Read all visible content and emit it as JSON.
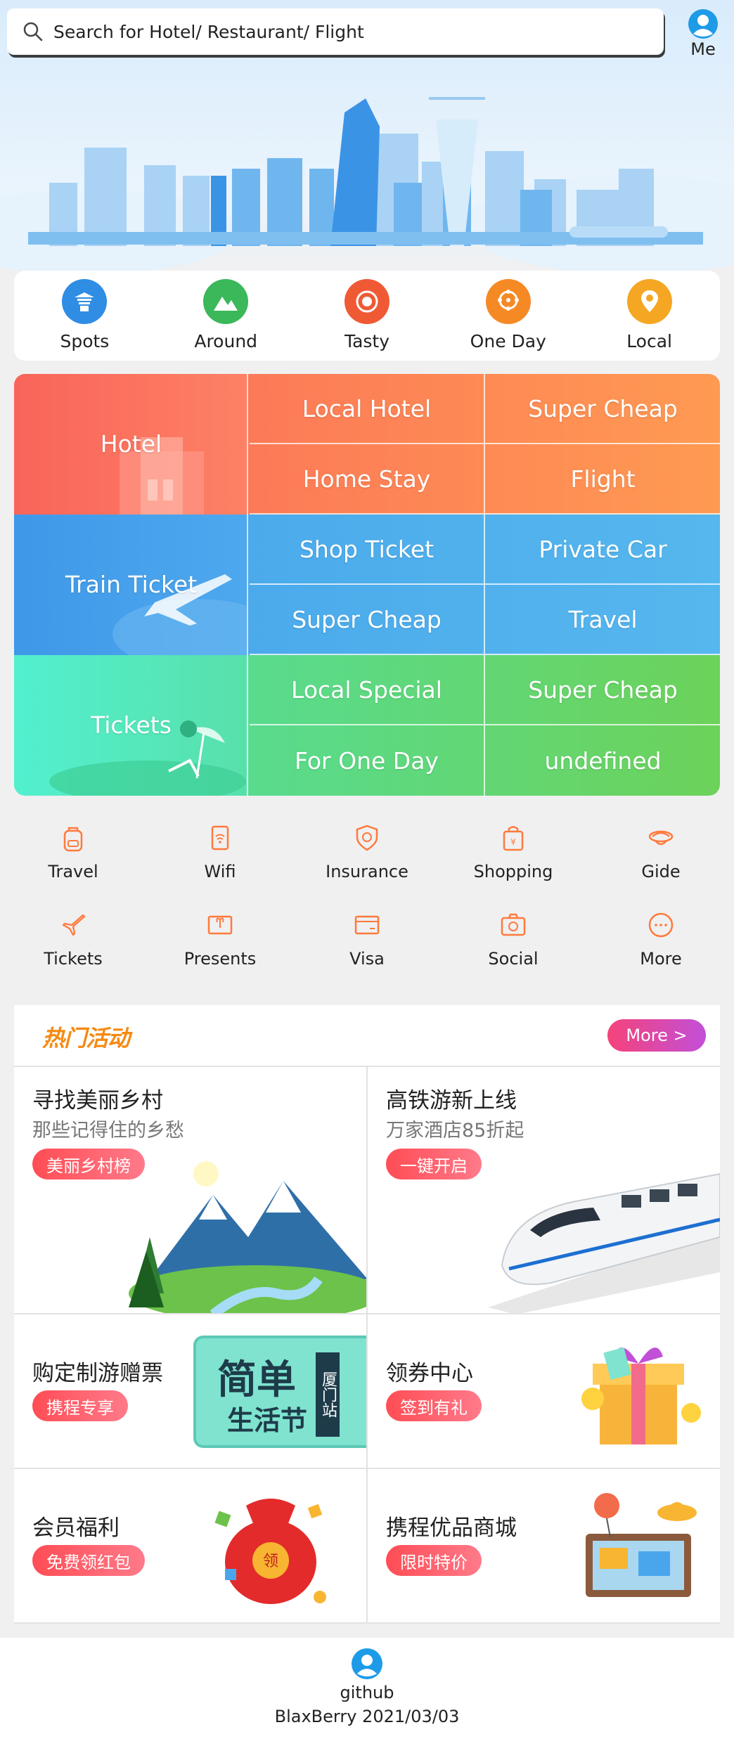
{
  "search": {
    "placeholder": "Search for Hotel/ Restaurant/ Flight",
    "icon": "search-icon"
  },
  "header": {
    "me_label": "Me"
  },
  "quick_nav": [
    {
      "label": "Spots",
      "icon": "pagoda-icon",
      "color": "#2f8de4"
    },
    {
      "label": "Around",
      "icon": "mountain-icon",
      "color": "#3bb85a"
    },
    {
      "label": "Tasty",
      "icon": "food-icon",
      "color": "#ef5a35"
    },
    {
      "label": "One Day",
      "icon": "ferris-wheel-icon",
      "color": "#f58a25"
    },
    {
      "label": "Local",
      "icon": "location-icon",
      "color": "#f5a623"
    }
  ],
  "grid": {
    "hotel": {
      "label": "Hotel",
      "cells": [
        "Local Hotel",
        "Super Cheap",
        "Home Stay",
        "Flight"
      ],
      "color": "#ff7a55"
    },
    "train": {
      "label": "Train Ticket",
      "cells": [
        "Shop Ticket",
        "Private Car",
        "Super Cheap",
        "Travel"
      ],
      "color": "#4aa6ec"
    },
    "tickets": {
      "label": "Tickets",
      "cells": [
        "Local Special",
        "Super Cheap",
        "For One Day",
        "undefined"
      ],
      "color": "#4fe0a8"
    }
  },
  "services": [
    {
      "label": "Travel",
      "icon": "backpack-icon"
    },
    {
      "label": "Wifi",
      "icon": "wifi-icon"
    },
    {
      "label": "Insurance",
      "icon": "shield-icon"
    },
    {
      "label": "Shopping",
      "icon": "shopping-bag-icon"
    },
    {
      "label": "Gide",
      "icon": "guide-hat-icon"
    },
    {
      "label": "Tickets",
      "icon": "plane-icon"
    },
    {
      "label": "Presents",
      "icon": "gift-icon"
    },
    {
      "label": "Visa",
      "icon": "card-icon"
    },
    {
      "label": "Social",
      "icon": "camera-icon"
    },
    {
      "label": "More",
      "icon": "more-icon"
    }
  ],
  "hot": {
    "title": "热门活动",
    "more": "More >",
    "cards": [
      {
        "title": "寻找美丽乡村",
        "subtitle": "那些记得住的乡愁",
        "badge": "美丽乡村榜"
      },
      {
        "title": "高铁游新上线",
        "subtitle": "万家酒店85折起",
        "badge": "一键开启"
      },
      {
        "title": "购定制游赠票",
        "badge": "携程专享",
        "banner_big": "简单",
        "banner_small": "生活节",
        "banner_tag": "厦门站"
      },
      {
        "title": "领券中心",
        "badge": "签到有礼"
      },
      {
        "title": "会员福利",
        "badge": "免费领红包",
        "bag_text": "领"
      },
      {
        "title": "携程优品商城",
        "badge": "限时特价"
      }
    ]
  },
  "footer": {
    "link": "github",
    "copyright": "BlaxBerry 2021/03/03"
  },
  "colors": {
    "accent": "#ff7a3d",
    "badge": "#ff4d55",
    "more_button": "#e24a9b"
  }
}
